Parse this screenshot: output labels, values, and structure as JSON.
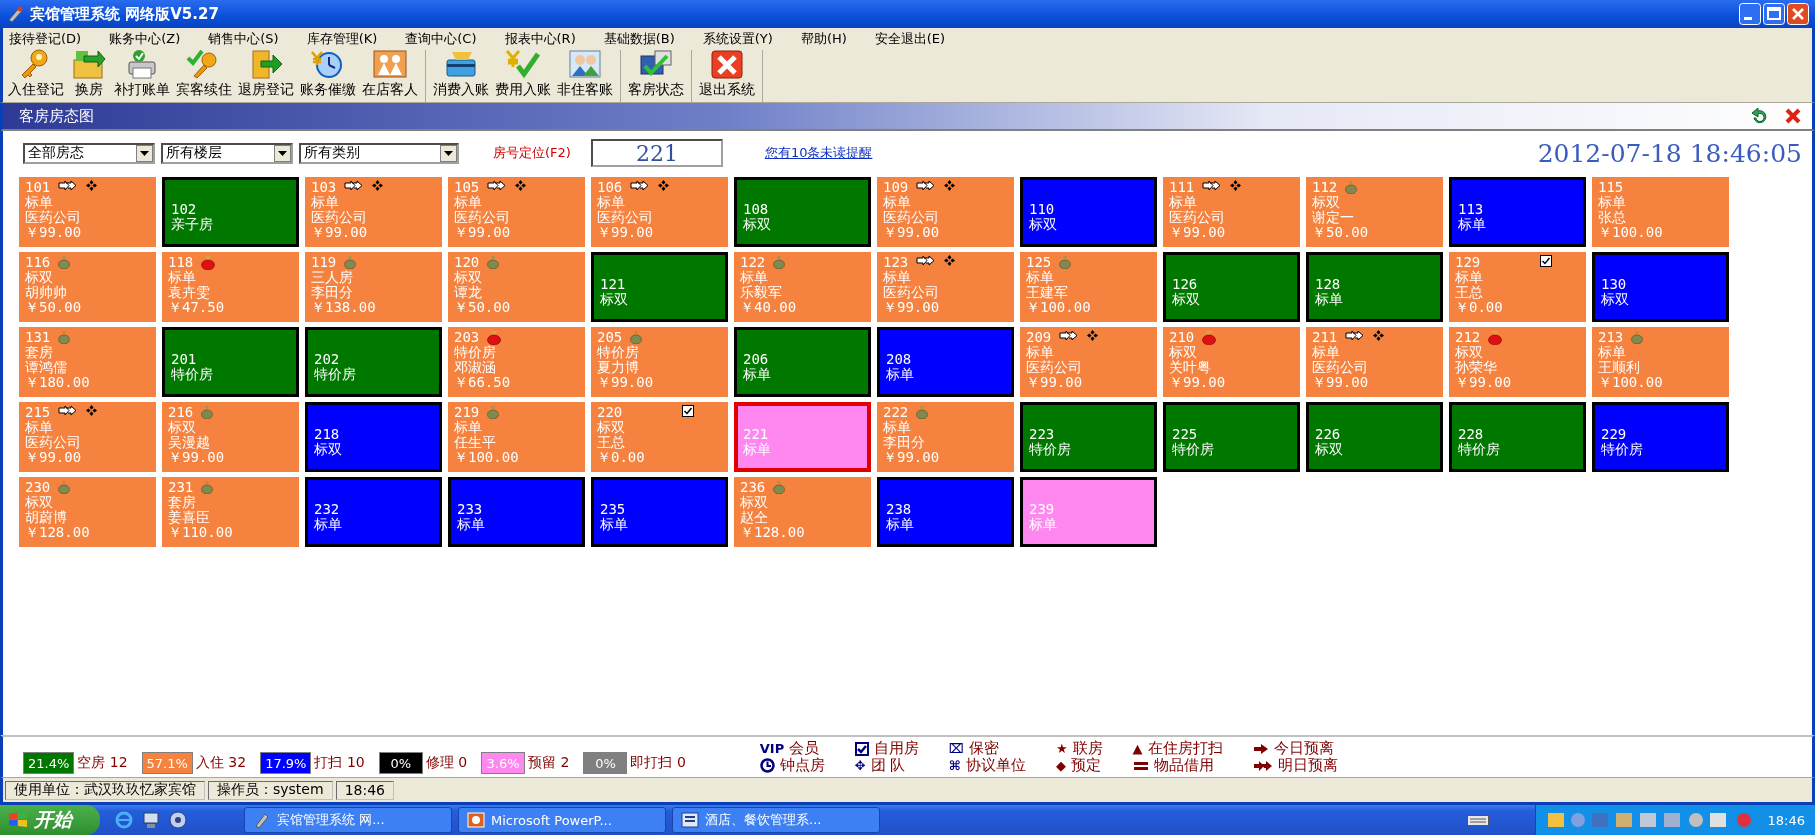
{
  "window": {
    "title": "宾馆管理系统 网络版V5.27"
  },
  "menu": [
    "接待登记(D)",
    "账务中心(Z)",
    "销售中心(S)",
    "库存管理(K)",
    "查询中心(C)",
    "报表中心(R)",
    "基础数据(B)",
    "系统设置(Y)",
    "帮助(H)",
    "安全退出(E)"
  ],
  "toolbar": [
    {
      "items": [
        {
          "label": "入住登记",
          "kind": "key"
        },
        {
          "label": "换房",
          "kind": "swap"
        },
        {
          "label": "补打账单",
          "kind": "printer"
        },
        {
          "label": "宾客续住",
          "kind": "keycheck"
        },
        {
          "label": "退房登记",
          "kind": "exit"
        },
        {
          "label": "账务催缴",
          "kind": "clock"
        },
        {
          "label": "在店客人",
          "kind": "people"
        }
      ]
    },
    {
      "items": [
        {
          "label": "消费入账",
          "kind": "card"
        },
        {
          "label": "费用入账",
          "kind": "yen"
        },
        {
          "label": "非住客账",
          "kind": "person"
        }
      ]
    },
    {
      "items": [
        {
          "label": "客房状态",
          "kind": "status"
        }
      ]
    },
    {
      "items": [
        {
          "label": "退出系统",
          "kind": "quit"
        }
      ]
    }
  ],
  "panel": {
    "title": "客房房态图"
  },
  "filters": {
    "dropdowns": [
      "全部房态",
      "所有楼层",
      "所有类别"
    ],
    "locate_label": "房号定位(F2)",
    "room_field": {
      "value": "221"
    },
    "reminder_link": "您有10条未读提醒",
    "datetime": "2012-07-18 18:46:05"
  },
  "rooms": [
    {
      "number": "101",
      "type": "标单",
      "guest": "医药公司",
      "price": "￥99.00",
      "kind": "occupied",
      "selected": false,
      "icons": [
        {
          "kind": "arrow"
        },
        {
          "kind": "team"
        }
      ]
    },
    {
      "number": "102",
      "type": "亲子房",
      "kind": "vacant",
      "selected": false
    },
    {
      "number": "103",
      "type": "标单",
      "guest": "医药公司",
      "price": "￥99.00",
      "kind": "occupied",
      "selected": false,
      "icons": [
        {
          "kind": "arrow"
        },
        {
          "kind": "team"
        }
      ]
    },
    {
      "number": "105",
      "type": "标单",
      "guest": "医药公司",
      "price": "￥99.00",
      "kind": "occupied",
      "selected": false,
      "icons": [
        {
          "kind": "arrow"
        },
        {
          "kind": "team"
        }
      ]
    },
    {
      "number": "106",
      "type": "标单",
      "guest": "医药公司",
      "price": "￥99.00",
      "kind": "occupied",
      "selected": false,
      "icons": [
        {
          "kind": "arrow"
        },
        {
          "kind": "team"
        }
      ]
    },
    {
      "number": "108",
      "type": "标双",
      "kind": "vacant",
      "selected": false
    },
    {
      "number": "109",
      "type": "标单",
      "guest": "医药公司",
      "price": "￥99.00",
      "kind": "occupied",
      "selected": false,
      "icons": [
        {
          "kind": "arrow"
        },
        {
          "kind": "team"
        }
      ]
    },
    {
      "number": "110",
      "type": "标双",
      "kind": "cleaning",
      "selected": false
    },
    {
      "number": "111",
      "type": "标单",
      "guest": "医药公司",
      "price": "￥99.00",
      "kind": "occupied",
      "selected": false,
      "icons": [
        {
          "kind": "arrow"
        },
        {
          "kind": "team"
        }
      ]
    },
    {
      "number": "112",
      "type": "标双",
      "guest": "谢定一",
      "price": "￥50.00",
      "kind": "occupied",
      "selected": false,
      "icons": [
        {
          "kind": "bag"
        }
      ]
    },
    {
      "number": "113",
      "type": "标单",
      "kind": "cleaning",
      "selected": false
    },
    {
      "number": "115",
      "type": "标单",
      "guest": "张总",
      "price": "￥100.00",
      "kind": "occupied",
      "selected": false
    },
    {
      "number": "116",
      "type": "标双",
      "guest": "胡帅帅",
      "price": "￥50.00",
      "kind": "occupied",
      "selected": false,
      "icons": [
        {
          "kind": "bag"
        }
      ]
    },
    {
      "number": "118",
      "type": "标单",
      "guest": "袁卉雯",
      "price": "￥47.50",
      "kind": "occupied",
      "selected": false,
      "icons": [
        {
          "kind": "redbag"
        }
      ]
    },
    {
      "number": "119",
      "type": "三人房",
      "guest": "李田分",
      "price": "￥138.00",
      "kind": "occupied",
      "selected": false,
      "icons": [
        {
          "kind": "bag"
        }
      ]
    },
    {
      "number": "120",
      "type": "标双",
      "guest": "谭龙",
      "price": "￥50.00",
      "kind": "occupied",
      "selected": false,
      "icons": [
        {
          "kind": "bag"
        }
      ]
    },
    {
      "number": "121",
      "type": "标双",
      "kind": "vacant",
      "selected": false
    },
    {
      "number": "122",
      "type": "标单",
      "guest": "乐毅军",
      "price": "￥40.00",
      "kind": "occupied",
      "selected": false,
      "icons": [
        {
          "kind": "bag"
        }
      ]
    },
    {
      "number": "123",
      "type": "标单",
      "guest": "医药公司",
      "price": "￥99.00",
      "kind": "occupied",
      "selected": false,
      "icons": [
        {
          "kind": "arrow"
        },
        {
          "kind": "team"
        }
      ]
    },
    {
      "number": "125",
      "type": "标单",
      "guest": "王建军",
      "price": "￥100.00",
      "kind": "occupied",
      "selected": false,
      "icons": [
        {
          "kind": "bag"
        }
      ]
    },
    {
      "number": "126",
      "type": "标双",
      "kind": "vacant",
      "selected": false
    },
    {
      "number": "128",
      "type": "标单",
      "kind": "vacant",
      "selected": false
    },
    {
      "number": "129",
      "type": "标单",
      "guest": "王总",
      "price": "￥0.00",
      "kind": "occupied",
      "selected": false,
      "icons": [
        {
          "kind": "check"
        }
      ]
    },
    {
      "number": "130",
      "type": "标双",
      "kind": "cleaning",
      "selected": false
    },
    {
      "number": "131",
      "type": "套房",
      "guest": "谭鸿儒",
      "price": "￥180.00",
      "kind": "occupied",
      "selected": false,
      "icons": [
        {
          "kind": "bag"
        }
      ]
    },
    {
      "number": "201",
      "type": "特价房",
      "kind": "vacant",
      "selected": false
    },
    {
      "number": "202",
      "type": "特价房",
      "kind": "vacant",
      "selected": false
    },
    {
      "number": "203",
      "type": "特价房",
      "guest": "邓淑涵",
      "price": "￥66.50",
      "kind": "occupied",
      "selected": false,
      "icons": [
        {
          "kind": "redbag"
        }
      ]
    },
    {
      "number": "205",
      "type": "特价房",
      "guest": "夏力博",
      "price": "￥99.00",
      "kind": "occupied",
      "selected": false,
      "icons": [
        {
          "kind": "bag"
        }
      ]
    },
    {
      "number": "206",
      "type": "标单",
      "kind": "vacant",
      "selected": false
    },
    {
      "number": "208",
      "type": "标单",
      "kind": "cleaning",
      "selected": false
    },
    {
      "number": "209",
      "type": "标单",
      "guest": "医药公司",
      "price": "￥99.00",
      "kind": "occupied",
      "selected": false,
      "icons": [
        {
          "kind": "arrow"
        },
        {
          "kind": "team"
        }
      ]
    },
    {
      "number": "210",
      "type": "标双",
      "guest": "关叶粤",
      "price": "￥99.00",
      "kind": "occupied",
      "selected": false,
      "icons": [
        {
          "kind": "redbag"
        }
      ]
    },
    {
      "number": "211",
      "type": "标单",
      "guest": "医药公司",
      "price": "￥99.00",
      "kind": "occupied",
      "selected": false,
      "icons": [
        {
          "kind": "arrow"
        },
        {
          "kind": "team"
        }
      ]
    },
    {
      "number": "212",
      "type": "标双",
      "guest": "孙荣华",
      "price": "￥99.00",
      "kind": "occupied",
      "selected": false,
      "icons": [
        {
          "kind": "redbag"
        }
      ]
    },
    {
      "number": "213",
      "type": "标单",
      "guest": "王顺利",
      "price": "￥100.00",
      "kind": "occupied",
      "selected": false,
      "icons": [
        {
          "kind": "bag"
        }
      ]
    },
    {
      "number": "215",
      "type": "标单",
      "guest": "医药公司",
      "price": "￥99.00",
      "kind": "occupied",
      "selected": false,
      "icons": [
        {
          "kind": "arrow"
        },
        {
          "kind": "team"
        }
      ]
    },
    {
      "number": "216",
      "type": "标双",
      "guest": "吴漫越",
      "price": "￥99.00",
      "kind": "occupied",
      "selected": false,
      "icons": [
        {
          "kind": "bag"
        }
      ]
    },
    {
      "number": "218",
      "type": "标双",
      "kind": "cleaning",
      "selected": false
    },
    {
      "number": "219",
      "type": "标单",
      "guest": "任生平",
      "price": "￥100.00",
      "kind": "occupied",
      "selected": false,
      "icons": [
        {
          "kind": "bag"
        }
      ]
    },
    {
      "number": "220",
      "type": "标双",
      "guest": "王总",
      "price": "￥0.00",
      "kind": "occupied",
      "selected": false,
      "icons": [
        {
          "kind": "check"
        }
      ]
    },
    {
      "number": "221",
      "type": "标单",
      "kind": "reserved",
      "selected": true
    },
    {
      "number": "222",
      "type": "标单",
      "guest": "李田分",
      "price": "￥99.00",
      "kind": "occupied",
      "selected": false,
      "icons": [
        {
          "kind": "bag"
        }
      ]
    },
    {
      "number": "223",
      "type": "特价房",
      "kind": "vacant",
      "selected": false
    },
    {
      "number": "225",
      "type": "特价房",
      "kind": "vacant",
      "selected": false
    },
    {
      "number": "226",
      "type": "标双",
      "kind": "vacant",
      "selected": false
    },
    {
      "number": "228",
      "type": "特价房",
      "kind": "vacant",
      "selected": false
    },
    {
      "number": "229",
      "type": "特价房",
      "kind": "cleaning",
      "selected": false
    },
    {
      "number": "230",
      "type": "标双",
      "guest": "胡蔚博",
      "price": "￥128.00",
      "kind": "occupied",
      "selected": false,
      "icons": [
        {
          "kind": "bag"
        }
      ]
    },
    {
      "number": "231",
      "type": "套房",
      "guest": "姜喜臣",
      "price": "￥110.00",
      "kind": "occupied",
      "selected": false,
      "icons": [
        {
          "kind": "bag"
        }
      ]
    },
    {
      "number": "232",
      "type": "标单",
      "kind": "cleaning",
      "selected": false
    },
    {
      "number": "233",
      "type": "标单",
      "kind": "cleaning",
      "selected": false
    },
    {
      "number": "235",
      "type": "标单",
      "kind": "cleaning",
      "selected": false
    },
    {
      "number": "236",
      "type": "标双",
      "guest": "赵仝",
      "price": "￥128.00",
      "kind": "occupied",
      "selected": false,
      "icons": [
        {
          "kind": "bag"
        }
      ]
    },
    {
      "number": "238",
      "type": "标单",
      "kind": "cleaning",
      "selected": false
    },
    {
      "number": "239",
      "type": "标单",
      "kind": "reserved",
      "selected": false
    }
  ],
  "stats": [
    {
      "percent": "21.4%",
      "label": "空房 12",
      "color": "#007800"
    },
    {
      "percent": "57.1%",
      "label": "入住 32",
      "color": "#f5823f"
    },
    {
      "percent": "17.9%",
      "label": "打扫 10",
      "color": "#0000ff"
    },
    {
      "percent": "0%",
      "label": "修理 0",
      "color": "#000000"
    },
    {
      "percent": "3.6%",
      "label": "预留 2",
      "color": "#ff88f0"
    },
    {
      "percent": "0%",
      "label": "即打扫 0",
      "color": "#808080"
    }
  ],
  "legend": [
    {
      "symbol": "VIP",
      "label": "会员",
      "color": "#000080"
    },
    {
      "kind": "check",
      "label": "自用房",
      "color": "#000080"
    },
    {
      "symbol": "⌧",
      "label": "保密",
      "color": "#000080"
    },
    {
      "symbol": "★",
      "label": "联房",
      "color": "#800000"
    },
    {
      "symbol": "▲",
      "label": "在住房打扫",
      "color": "#800000"
    },
    {
      "kind": "arrow",
      "label": "今日预离",
      "color": "#800000"
    },
    {
      "kind": "clock",
      "label": "钟点房",
      "color": "#000080"
    },
    {
      "symbol": "✥",
      "label": "团 队",
      "color": "#000080"
    },
    {
      "symbol": "⌘",
      "label": "协议单位",
      "color": "#000080"
    },
    {
      "symbol": "◆",
      "label": "预定",
      "color": "#800000"
    },
    {
      "kind": "bars",
      "label": "物品借用",
      "color": "#800000"
    },
    {
      "kind": "double-arrow",
      "label": "明日预离",
      "color": "#800000"
    }
  ],
  "status_bar": [
    "使用单位：武汉玖玖忆家宾馆",
    "操作员：system",
    "18:46"
  ],
  "taskbar": {
    "start": "开始",
    "tasks": [
      "宾馆管理系统 网...",
      "Microsoft PowerP...",
      "酒店、餐饮管理系..."
    ],
    "clock": "18:46"
  }
}
